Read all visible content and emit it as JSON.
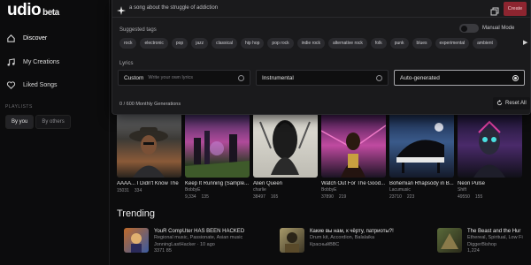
{
  "app": {
    "logo": "udio",
    "badge": "beta"
  },
  "sidebar": {
    "items": [
      {
        "label": "Discover",
        "icon": "home-icon",
        "active": true
      },
      {
        "label": "My Creations",
        "icon": "music-icon",
        "active": false
      },
      {
        "label": "Liked Songs",
        "icon": "heart-icon",
        "active": false
      }
    ],
    "playlists_label": "PLAYLISTS",
    "playlist_tabs": [
      {
        "label": "By you",
        "active": true
      },
      {
        "label": "By others",
        "active": false
      }
    ]
  },
  "create": {
    "prompt": "a song about the struggle of addiction",
    "create_label": "Create",
    "suggested_label": "Suggested tags",
    "manual_mode_label": "Manual Mode",
    "tags": [
      "rock",
      "electronic",
      "pop",
      "jazz",
      "classical",
      "hip hop",
      "pop rock",
      "indie rock",
      "alternative rock",
      "folk",
      "punk",
      "blues",
      "experimental",
      "ambient"
    ],
    "lyrics_label": "Lyrics",
    "lyrics_options": [
      {
        "label": "Custom",
        "sub": "Write your own lyrics",
        "selected": false
      },
      {
        "label": "Instrumental",
        "sub": "",
        "selected": false
      },
      {
        "label": "Auto-generated",
        "sub": "",
        "selected": true
      }
    ],
    "generations": "0 / 600 Monthly Generations",
    "reset_label": "Reset All"
  },
  "cards": [
    {
      "title": "AAAA... I Didn't Know The",
      "artist": "",
      "plays": "15031",
      "likes": "334"
    },
    {
      "title": "Keep It Running (Sample...",
      "artist": "BobbyE",
      "plays": "9,334",
      "likes": "135"
    },
    {
      "title": "Alien Queen",
      "artist": "charlie",
      "plays": "38497",
      "likes": "165"
    },
    {
      "title": "Watch Out For The Good...",
      "artist": "BobbyE",
      "plays": "37890",
      "likes": "219"
    },
    {
      "title": "Bohemian Rhapsody in B...",
      "artist": "Lacumusic",
      "plays": "23710",
      "likes": "223"
    },
    {
      "title": "Neon Pulse",
      "artist": "Shift",
      "plays": "49550",
      "likes": "155"
    }
  ],
  "trending": {
    "title": "Trending",
    "items": [
      {
        "title": "YouR CompUter HAS BEEN HACKED",
        "tags": "Regional music, Passionate, Asian music",
        "artist": "JonningLastHacker",
        "time": "10 ago",
        "plays": "3371",
        "likes": "85"
      },
      {
        "title": "Какие вы нам, к чёрту, патриоты?!",
        "tags": "Drum kit, Accordion, Balalaika",
        "artist": "КрасныйВВС",
        "time": "",
        "plays": "",
        "likes": ""
      },
      {
        "title": "The Beast and the Hur",
        "tags": "Ethereal, Spiritual, Low Fi",
        "artist": "DiggerBishop",
        "time": "",
        "plays": "1,224",
        "likes": ""
      }
    ]
  },
  "colors": {
    "create": "#8d2530",
    "bg": "#0c0c0d",
    "panel": "#1a1a1c"
  }
}
